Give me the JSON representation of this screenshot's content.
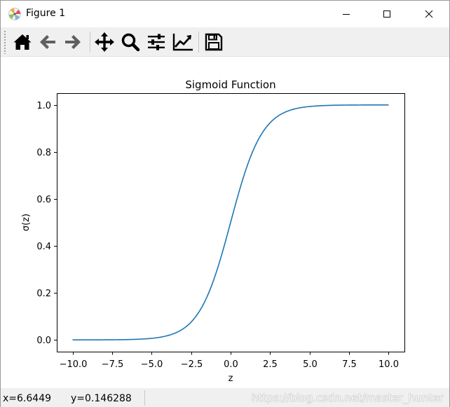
{
  "window": {
    "title": "Figure 1",
    "minimize_icon": "minimize-icon",
    "maximize_icon": "maximize-icon",
    "close_icon": "close-icon"
  },
  "toolbar": {
    "buttons": [
      {
        "name": "home-button",
        "icon": "home-icon"
      },
      {
        "name": "back-button",
        "icon": "arrow-left-icon"
      },
      {
        "name": "forward-button",
        "icon": "arrow-right-icon"
      },
      {
        "name": "pan-button",
        "icon": "move-icon"
      },
      {
        "name": "zoom-button",
        "icon": "magnifier-icon"
      },
      {
        "name": "configure-subplots-button",
        "icon": "sliders-icon"
      },
      {
        "name": "edit-axes-button",
        "icon": "chart-trend-icon"
      },
      {
        "name": "save-button",
        "icon": "floppy-disk-icon"
      }
    ]
  },
  "chart_data": {
    "type": "line",
    "title": "Sigmoid Function",
    "xlabel": "z",
    "ylabel": "σ(z)",
    "xlim": [
      -11.0,
      11.0
    ],
    "ylim": [
      -0.05,
      1.05
    ],
    "xticks": [
      -10.0,
      -7.5,
      -5.0,
      -2.5,
      0.0,
      2.5,
      5.0,
      7.5,
      10.0
    ],
    "xtick_labels": [
      "−10.0",
      "−7.5",
      "−5.0",
      "−2.5",
      "0.0",
      "2.5",
      "5.0",
      "7.5",
      "10.0"
    ],
    "yticks": [
      0.0,
      0.2,
      0.4,
      0.6,
      0.8,
      1.0
    ],
    "ytick_labels": [
      "0.0",
      "0.2",
      "0.4",
      "0.6",
      "0.8",
      "1.0"
    ],
    "grid": false,
    "series": [
      {
        "color": "#1f77b4",
        "x": [
          -10,
          -9,
          -8,
          -7,
          -6,
          -5,
          -4,
          -3.5,
          -3,
          -2.5,
          -2,
          -1.5,
          -1,
          -0.5,
          0,
          0.5,
          1,
          1.5,
          2,
          2.5,
          3,
          3.5,
          4,
          5,
          6,
          7,
          8,
          9,
          10
        ],
        "y": [
          4.54e-05,
          0.000123,
          0.000335,
          0.000911,
          0.00247,
          0.00669,
          0.018,
          0.0293,
          0.0474,
          0.0759,
          0.1192,
          0.1824,
          0.2689,
          0.3775,
          0.5,
          0.6225,
          0.7311,
          0.8176,
          0.8808,
          0.9241,
          0.9526,
          0.9707,
          0.982,
          0.9933,
          0.9975,
          0.9991,
          0.99966,
          0.99988,
          0.99995
        ]
      }
    ]
  },
  "status": {
    "x_readout": "x=6.6449",
    "y_readout": "y=0.146288",
    "watermark": "https://blog.csdn.net/master_hunter"
  }
}
